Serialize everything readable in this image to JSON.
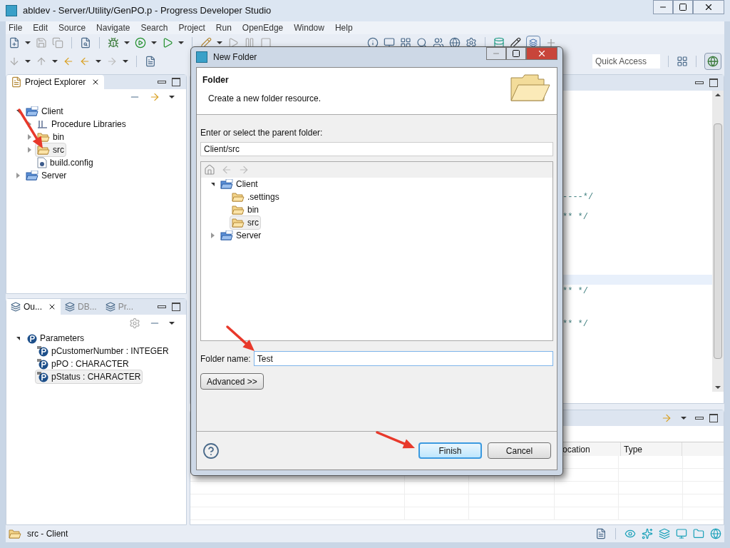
{
  "window": {
    "title": "abldev - Server/Utility/GenPO.p - Progress Developer Studio"
  },
  "menu": [
    "File",
    "Edit",
    "Source",
    "Navigate",
    "Search",
    "Project",
    "Run",
    "OpenEdge",
    "Window",
    "Help"
  ],
  "quick_access": {
    "placeholder": "Quick Access"
  },
  "project_explorer": {
    "title": "Project Explorer",
    "tree": [
      {
        "label": "Client",
        "kind": "project",
        "expanded": true,
        "selected": false,
        "children": [
          {
            "label": "Procedure Libraries",
            "kind": "library",
            "expanded": false,
            "selected": false
          },
          {
            "label": "bin",
            "kind": "folder",
            "expanded": false,
            "selected": false
          },
          {
            "label": "src",
            "kind": "folder",
            "expanded": false,
            "selected": true
          },
          {
            "label": "build.config",
            "kind": "file",
            "selected": false
          }
        ]
      },
      {
        "label": "Server",
        "kind": "project",
        "expanded": false,
        "selected": false
      }
    ]
  },
  "outline": {
    "tabs": [
      {
        "label": "Ou...",
        "selected": true
      },
      {
        "label": "DB...",
        "selected": false
      },
      {
        "label": "Pr...",
        "selected": false
      }
    ],
    "tree": [
      {
        "label": "Parameters",
        "kind": "parameters",
        "expanded": true,
        "selected": false,
        "children": [
          {
            "label": "pCustomerNumber : INTEGER",
            "kind": "parameter",
            "selected": false
          },
          {
            "label": "pPO : CHARACTER",
            "kind": "parameter",
            "selected": false
          },
          {
            "label": "pStatus : CHARACTER",
            "kind": "parameter",
            "selected": true
          }
        ]
      }
    ]
  },
  "editor": {
    "lines": [
      {
        "text": "----*/"
      },
      {
        "text": "** */"
      },
      {
        "text": "** */"
      },
      {
        "text": "** */"
      }
    ]
  },
  "bottom_panel": {
    "columns": [
      {
        "label": "ocation"
      },
      {
        "label": "Type"
      }
    ]
  },
  "dialog": {
    "title": "New Folder",
    "heading": "Folder",
    "description": "Create a new folder resource.",
    "parent_label": "Enter or select the parent folder:",
    "parent_value": "Client/src",
    "tree": [
      {
        "label": "Client",
        "kind": "project",
        "expanded": true,
        "selected": false,
        "children": [
          {
            "label": ".settings",
            "kind": "folder",
            "selected": false
          },
          {
            "label": "bin",
            "kind": "folder",
            "selected": false
          },
          {
            "label": "src",
            "kind": "folder",
            "selected": true
          }
        ]
      },
      {
        "label": "Server",
        "kind": "project",
        "expanded": false,
        "selected": false
      }
    ],
    "folder_name_label": "Folder name:",
    "folder_name_value": "Test",
    "buttons": [
      {
        "label": "Advanced >>",
        "kind": "advanced",
        "default": false
      },
      {
        "label": "Finish",
        "kind": "action",
        "default": true
      },
      {
        "label": "Cancel",
        "kind": "action",
        "default": false
      }
    ]
  },
  "status_bar": {
    "text": "src - Client"
  }
}
